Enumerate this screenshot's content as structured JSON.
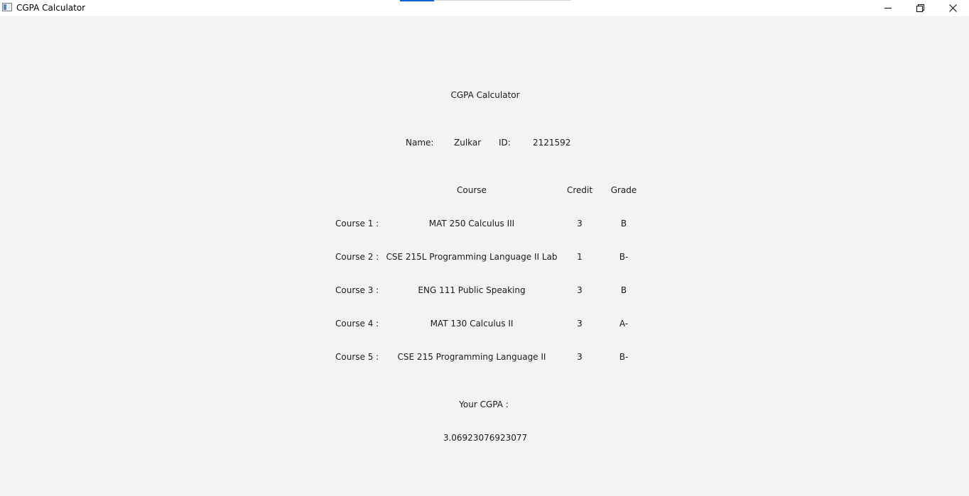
{
  "window": {
    "title": "CGPA Calculator",
    "progress": 0.2
  },
  "header": {
    "title": "CGPA Calculator"
  },
  "student": {
    "name_label": "Name:",
    "name_value": "Zulkar",
    "id_label": "ID:",
    "id_value": "2121592"
  },
  "table": {
    "columns": {
      "course": "Course",
      "credit": "Credit",
      "grade": "Grade"
    },
    "rows": [
      {
        "label": "Course 1 :",
        "course": "MAT 250 Calculus III",
        "credit": "3",
        "grade": "B"
      },
      {
        "label": "Course 2 :",
        "course": "CSE 215L Programming Language II Lab",
        "credit": "1",
        "grade": "B-"
      },
      {
        "label": "Course 3 :",
        "course": "ENG 111 Public Speaking",
        "credit": "3",
        "grade": "B"
      },
      {
        "label": "Course 4 :",
        "course": "MAT 130 Calculus II",
        "credit": "3",
        "grade": "A-"
      },
      {
        "label": "Course 5 :",
        "course": "CSE 215 Programming Language II",
        "credit": "3",
        "grade": "B-"
      }
    ]
  },
  "result": {
    "label": "Your CGPA :",
    "value": "3.06923076923077"
  },
  "icons": {
    "app": "app-window-icon",
    "minimize": "minimize-icon",
    "maximize": "restore-icon",
    "close": "close-icon"
  }
}
